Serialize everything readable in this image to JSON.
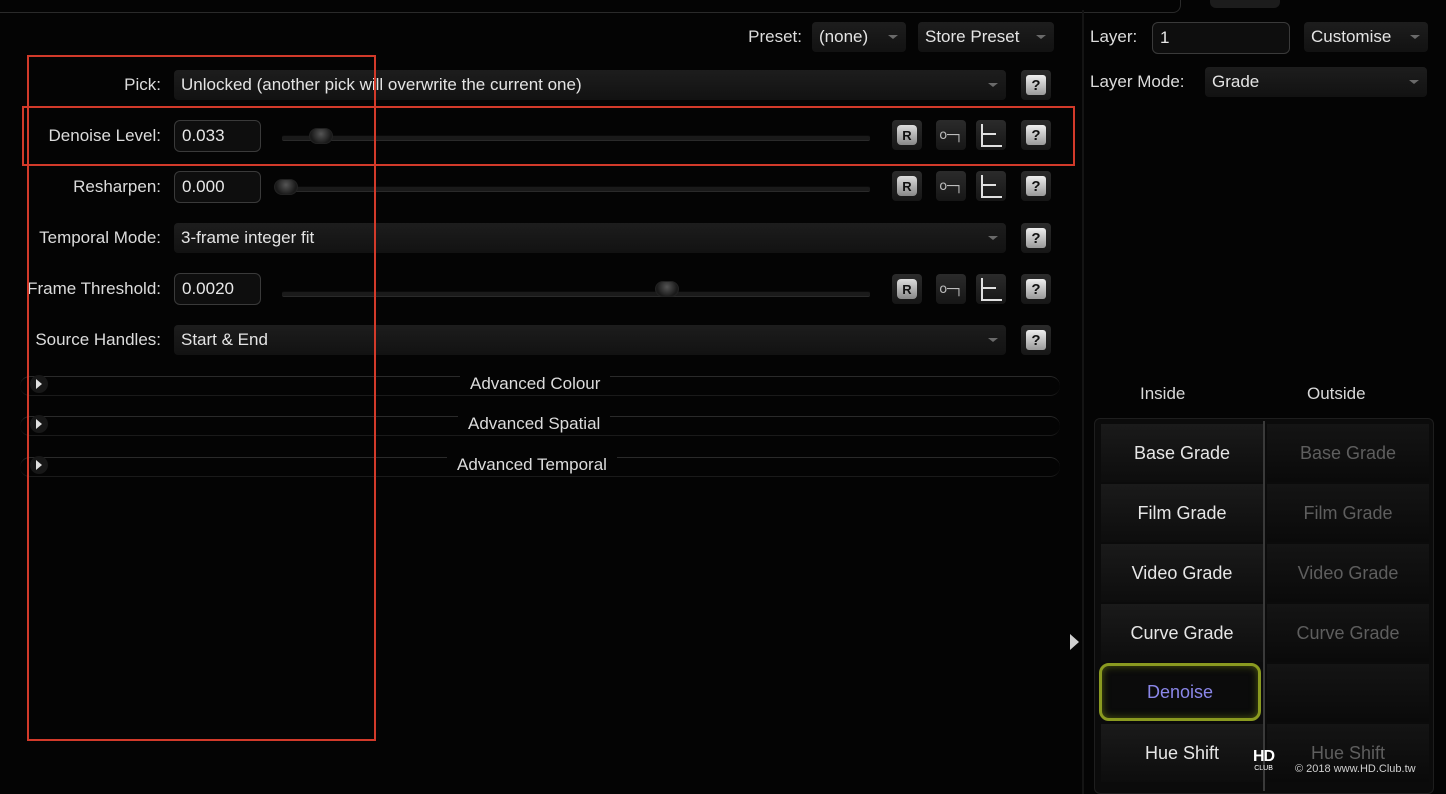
{
  "header": {
    "preset_label": "Preset:",
    "preset_value": "(none)",
    "store_preset": "Store Preset"
  },
  "fields": {
    "pick": {
      "label": "Pick:",
      "value": "Unlocked (another pick will overwrite the current one)"
    },
    "denoise_level": {
      "label": "Denoise Level:",
      "value": "0.033",
      "slider": 0.033
    },
    "resharpen": {
      "label": "Resharpen:",
      "value": "0.000",
      "slider": 0.0
    },
    "temporal_mode": {
      "label": "Temporal Mode:",
      "value": "3-frame integer fit"
    },
    "frame_threshold": {
      "label": "Frame Threshold:",
      "value": "0.0020",
      "slider": 0.65
    },
    "source_handles": {
      "label": "Source Handles:",
      "value": "Start & End"
    }
  },
  "buttons": {
    "reset": "R",
    "help": "?"
  },
  "sections": [
    "Advanced Colour",
    "Advanced Spatial",
    "Advanced Temporal"
  ],
  "right_panel": {
    "layer_label": "Layer:",
    "layer_value": "1",
    "customise": "Customise",
    "layer_mode_label": "Layer Mode:",
    "layer_mode_value": "Grade",
    "inside_header": "Inside",
    "outside_header": "Outside",
    "rows": [
      {
        "inside": "Base Grade",
        "outside": "Base Grade"
      },
      {
        "inside": "Film Grade",
        "outside": "Film Grade"
      },
      {
        "inside": "Video Grade",
        "outside": "Video Grade"
      },
      {
        "inside": "Curve Grade",
        "outside": "Curve Grade"
      },
      {
        "inside": "Denoise",
        "outside": ""
      },
      {
        "inside": "Hue Shift",
        "outside": "Hue Shift"
      }
    ],
    "selected": "Denoise"
  },
  "watermark": {
    "logo": "HD",
    "logo_sub": "CLUB",
    "text": "© 2018 www.HD.Club.tw"
  },
  "colors": {
    "highlight_box": "#d23a2a",
    "selected_border": "#8a9a20",
    "selected_text": "#8a86e8"
  }
}
